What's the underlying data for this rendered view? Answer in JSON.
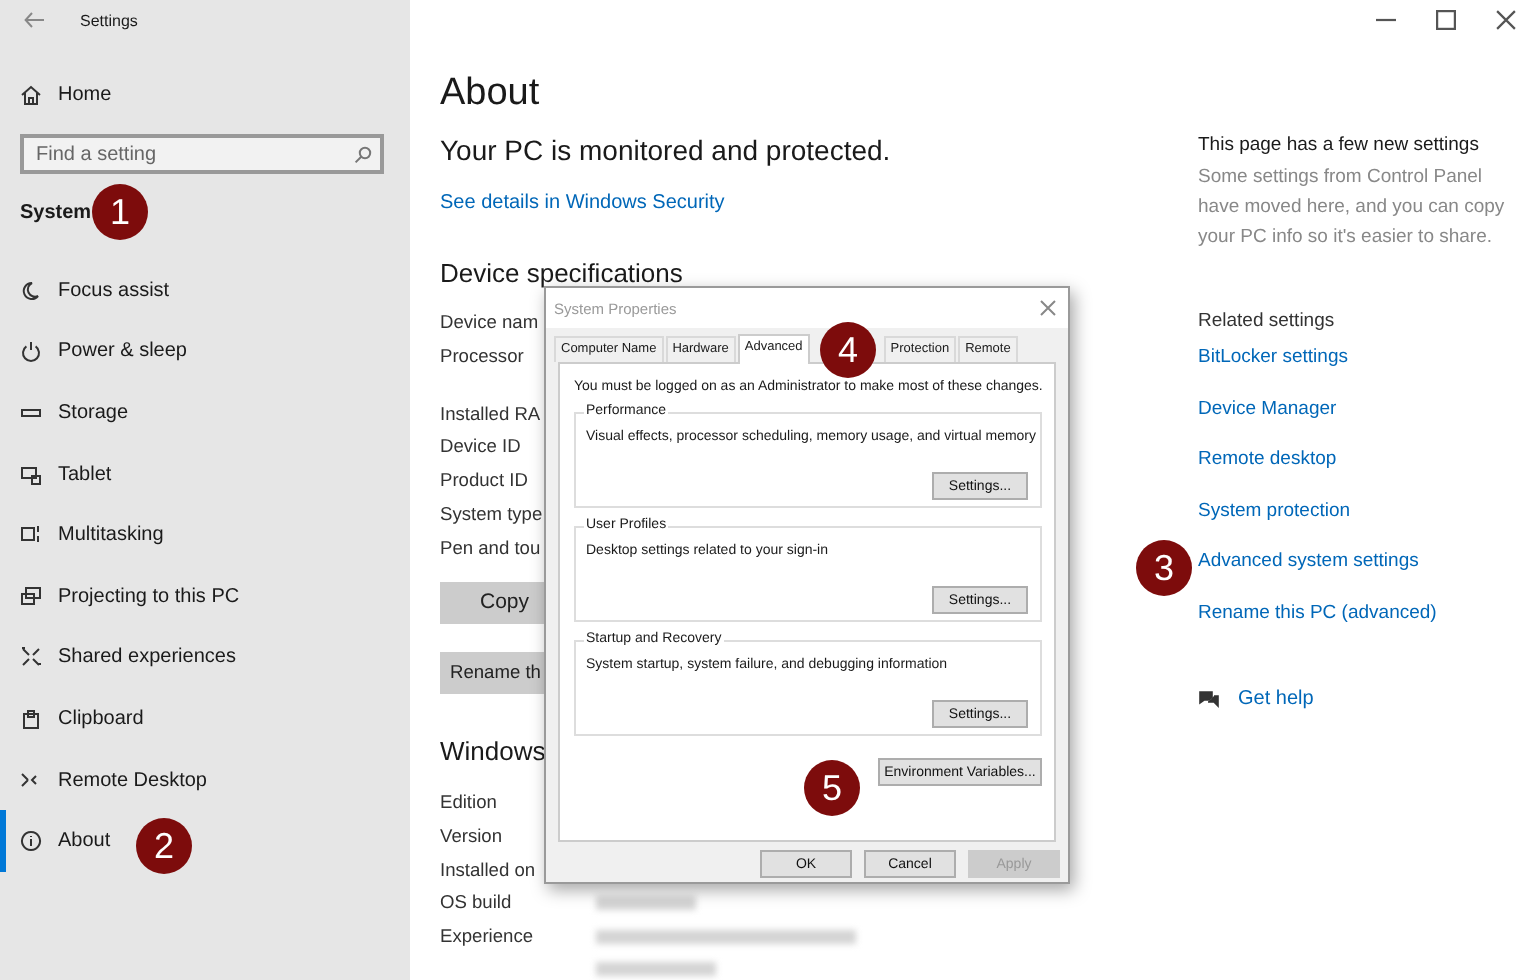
{
  "window": {
    "title": "Settings"
  },
  "sidebar": {
    "home": "Home",
    "search": {
      "placeholder": "Find a setting"
    },
    "section": "System",
    "items": [
      {
        "label": "Focus assist",
        "selected": false
      },
      {
        "label": "Power & sleep",
        "selected": false
      },
      {
        "label": "Storage",
        "selected": false
      },
      {
        "label": "Tablet",
        "selected": false
      },
      {
        "label": "Multitasking",
        "selected": false
      },
      {
        "label": "Projecting to this PC",
        "selected": false
      },
      {
        "label": "Shared experiences",
        "selected": false
      },
      {
        "label": "Clipboard",
        "selected": false
      },
      {
        "label": "Remote Desktop",
        "selected": false
      },
      {
        "label": "About",
        "selected": true
      }
    ]
  },
  "main": {
    "title": "About",
    "security_status": "Your PC is monitored and protected.",
    "security_link": "See details in Windows Security",
    "device_specs": {
      "heading": "Device specifications",
      "labels": [
        "Device nam",
        "Processor"
      ],
      "labels_2": [
        "Installed RA",
        "Device ID",
        "Product ID",
        "System type",
        "Pen and tou"
      ]
    },
    "buttons": [
      "Copy",
      "Rename th"
    ],
    "windows_specs": {
      "heading": "Windows",
      "labels": [
        "Edition",
        "Version",
        "Installed on",
        "OS build",
        "Experience"
      ]
    }
  },
  "right_panel": {
    "notice_title": "This page has a few new settings",
    "notice_text": "Some settings from Control Panel have moved here, and you can copy your PC info so it's easier to share.",
    "related_heading": "Related settings",
    "related_links": [
      "BitLocker settings",
      "Device Manager",
      "Remote desktop",
      "System protection",
      "Advanced system settings",
      "Rename this PC (advanced)"
    ],
    "help": "Get help"
  },
  "dialog": {
    "title": "System Properties",
    "tabs": [
      {
        "label": "Computer Name",
        "selected": false
      },
      {
        "label": "Hardware",
        "selected": false
      },
      {
        "label": "Advanced",
        "selected": true
      },
      {
        "label": "Protection",
        "selected": false
      },
      {
        "label": "Remote",
        "selected": false
      }
    ],
    "intro": "You must be logged on as an Administrator to make most of these changes.",
    "groups": [
      {
        "title": "Performance",
        "description": "Visual effects, processor scheduling, memory usage, and virtual memory",
        "button": "Settings..."
      },
      {
        "title": "User Profiles",
        "description": "Desktop settings related to your sign-in",
        "button": "Settings..."
      },
      {
        "title": "Startup and Recovery",
        "description": "System startup, system failure, and debugging information",
        "button": "Settings..."
      }
    ],
    "env_button": "Environment Variables...",
    "buttons": [
      {
        "label": "OK",
        "disabled": false
      },
      {
        "label": "Cancel",
        "disabled": false
      },
      {
        "label": "Apply",
        "disabled": true
      }
    ]
  },
  "callouts": [
    "1",
    "2",
    "3",
    "4",
    "5"
  ]
}
